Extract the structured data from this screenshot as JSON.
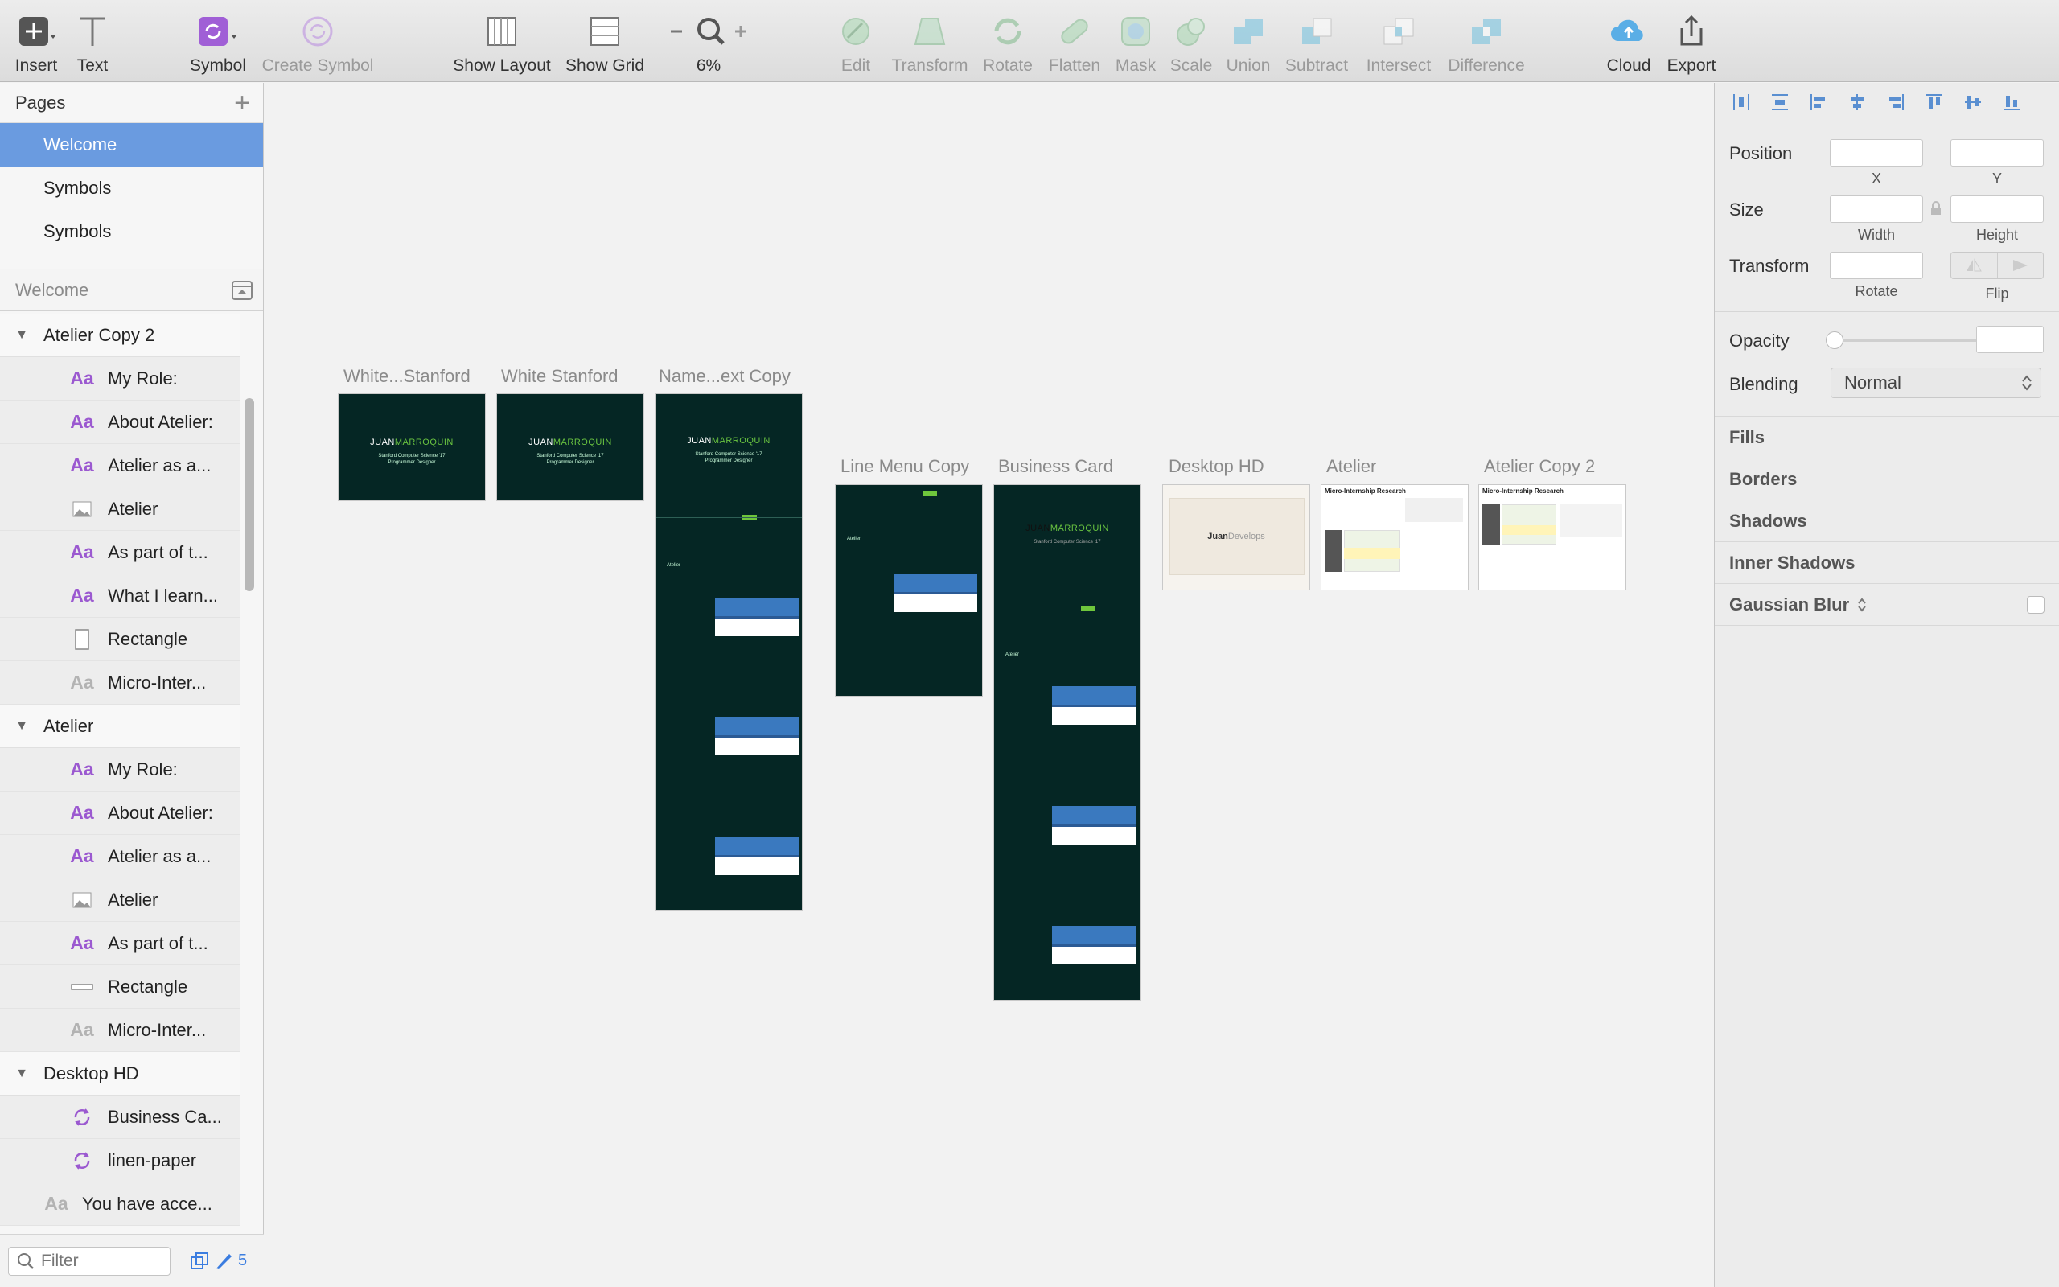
{
  "toolbar": {
    "insert": "Insert",
    "text": "Text",
    "symbol": "Symbol",
    "create_symbol": "Create Symbol",
    "show_layout": "Show Layout",
    "show_grid": "Show Grid",
    "zoom": "6%",
    "edit": "Edit",
    "transform": "Transform",
    "rotate": "Rotate",
    "flatten": "Flatten",
    "mask": "Mask",
    "scale": "Scale",
    "union": "Union",
    "subtract": "Subtract",
    "intersect": "Intersect",
    "difference": "Difference",
    "cloud": "Cloud",
    "export": "Export"
  },
  "pages": {
    "header": "Pages",
    "items": [
      "Welcome",
      "Symbols",
      "Symbols"
    ],
    "selected": "Welcome"
  },
  "layers": {
    "header": "Welcome",
    "groups": [
      {
        "name": "Atelier Copy 2",
        "items": [
          {
            "icon": "text-icon",
            "label": "My Role:"
          },
          {
            "icon": "text-icon",
            "label": "About Atelier:"
          },
          {
            "icon": "text-icon",
            "label": "Atelier as a..."
          },
          {
            "icon": "image-icon",
            "label": "Atelier"
          },
          {
            "icon": "text-icon",
            "label": "As part of t..."
          },
          {
            "icon": "text-icon",
            "label": "What I learn..."
          },
          {
            "icon": "rectangle-icon",
            "label": "Rectangle"
          },
          {
            "icon": "text-icon-dim",
            "label": "Micro-Inter..."
          }
        ]
      },
      {
        "name": "Atelier",
        "items": [
          {
            "icon": "text-icon",
            "label": "My Role:"
          },
          {
            "icon": "text-icon",
            "label": "About Atelier:"
          },
          {
            "icon": "text-icon",
            "label": "Atelier as a..."
          },
          {
            "icon": "image-icon",
            "label": "Atelier"
          },
          {
            "icon": "text-icon",
            "label": "As part of t..."
          },
          {
            "icon": "line-icon",
            "label": "Rectangle"
          },
          {
            "icon": "text-icon-dim",
            "label": "Micro-Inter..."
          }
        ]
      },
      {
        "name": "Desktop HD",
        "items": [
          {
            "icon": "symbol-icon",
            "label": "Business Ca..."
          },
          {
            "icon": "symbol-icon",
            "label": "linen-paper"
          }
        ]
      }
    ],
    "root_items": [
      {
        "icon": "text-icon-dim",
        "label": "You have acce..."
      }
    ],
    "text_glyph": "Aa"
  },
  "filter": {
    "placeholder": "Filter",
    "count": "5"
  },
  "artboards": {
    "white_stanford_1": "White...Stanford",
    "white_stanford_2": "White Stanford",
    "name_text_copy": "Name...ext Copy",
    "line_menu_copy": "Line Menu Copy",
    "business_card": "Business Card",
    "desktop_hd": "Desktop HD",
    "atelier": "Atelier",
    "atelier_copy_2": "Atelier Copy 2",
    "name_first": "JUAN",
    "name_last": "MARROQUIN",
    "tagline": "Stanford Computer Science '17",
    "role": "Programmer Designer",
    "card_title": "ATELIER",
    "desktop_text_a": "Juan",
    "desktop_text_b": "Develops",
    "research_title": "Micro-Internship Research",
    "atelier_small": "Atelier"
  },
  "inspector": {
    "position": "Position",
    "x": "X",
    "y": "Y",
    "size": "Size",
    "width": "Width",
    "height": "Height",
    "transform": "Transform",
    "rotate": "Rotate",
    "flip": "Flip",
    "opacity": "Opacity",
    "blending": "Blending",
    "blending_value": "Normal",
    "sections": [
      "Fills",
      "Borders",
      "Shadows",
      "Inner Shadows",
      "Gaussian Blur"
    ]
  },
  "colors": {
    "selection": "#6a9be0",
    "artboard_dark": "#052624",
    "accent_green": "#6fc63c",
    "card_blue": "#3a79bf",
    "symbol_purple": "#9b59d0"
  }
}
